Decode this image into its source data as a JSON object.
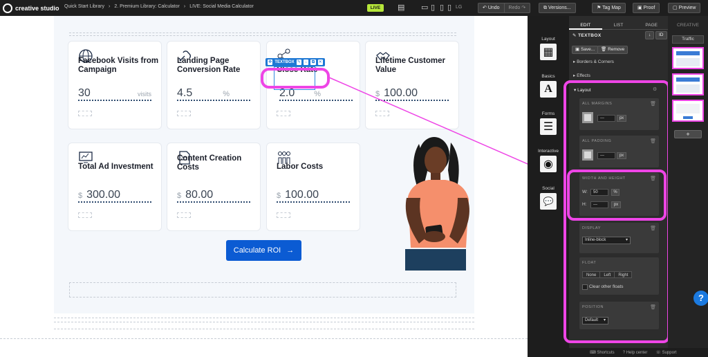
{
  "topbar": {
    "brand": "creative studio",
    "breadcrumbs": [
      "Quick Start Library",
      "›",
      "2. Premium Library: Calculator",
      "›",
      "LIVE: Social Media Calculator"
    ],
    "live_label": "LIVE",
    "device_label": "LG",
    "undo_label": "Undo",
    "redo_label": "Redo",
    "versions_label": "Versions...",
    "tagmap_label": "Tag Map",
    "proof_label": "Proof",
    "preview_label": "Preview"
  },
  "cards": [
    {
      "title": "Facebook Visits from Campaign",
      "prefix": "",
      "value": "30",
      "suffix": "visits",
      "icon": "globe-icon"
    },
    {
      "title": "Landing Page Conversion Rate",
      "prefix": "",
      "value": "4.5",
      "suffix": "%",
      "icon": "link-icon"
    },
    {
      "title": "Close Rate",
      "prefix": "",
      "value": "2.0",
      "suffix": "%",
      "icon": "share-icon"
    },
    {
      "title": "Lifetime Customer Value",
      "prefix": "$",
      "value": "100.00",
      "suffix": "",
      "icon": "handshake-icon"
    },
    {
      "title": "Total Ad Investment",
      "prefix": "$",
      "value": "300.00",
      "suffix": "",
      "icon": "monitor-icon"
    },
    {
      "title": "Content Creation Costs",
      "prefix": "$",
      "value": "80.00",
      "suffix": "",
      "icon": "document-icon"
    },
    {
      "title": "Labor Costs",
      "prefix": "$",
      "value": "100.00",
      "suffix": "",
      "icon": "people-icon"
    }
  ],
  "textbox_toolbar": {
    "label": "TEXTBOX"
  },
  "cta": {
    "label": "Calculate ROI",
    "arrow": "→"
  },
  "rail": [
    {
      "label": "Layout",
      "glyph": "▦"
    },
    {
      "label": "Basics",
      "glyph": "A"
    },
    {
      "label": "Forms",
      "glyph": "☰"
    },
    {
      "label": "Interactive",
      "glyph": "◉"
    },
    {
      "label": "Social",
      "glyph": "💬"
    }
  ],
  "props": {
    "tabs": [
      "EDIT",
      "LIST",
      "PAGE"
    ],
    "creative_tab": "CREATIVE",
    "title": "TEXTBOX",
    "id_label": "ID",
    "save_label": "Save...",
    "remove_label": "Remove",
    "borders_label": "Borders & Corners",
    "effects_label": "Effects",
    "layout_label": "Layout",
    "margins_label": "ALL MARGINS",
    "margins_value": "---",
    "margins_unit": "px",
    "padding_label": "ALL PADDING",
    "padding_value": "---",
    "padding_unit": "px",
    "wh_label": "WIDTH AND HEIGHT",
    "w_label": "W:",
    "w_value": "50",
    "w_unit": "%",
    "h_label": "H:",
    "h_value": "---",
    "h_unit": "px",
    "display_label": "DISPLAY",
    "display_value": "Inline-block",
    "float_label": "FLOAT",
    "float_options": [
      "None",
      "Left",
      "Right"
    ],
    "clear_floats_label": "Clear other floats",
    "position_label": "POSITION",
    "position_value": "Default"
  },
  "thumbs": {
    "traffic_label": "Traffic",
    "plus_label": "+"
  },
  "help_label": "?",
  "bottom_bar": {
    "shortcuts": "Shortcuts",
    "help_center": "Help center",
    "support": "Support"
  },
  "colors": {
    "accent": "#0b5bd3",
    "highlight": "#ee45e6",
    "live": "#b6e63a"
  }
}
